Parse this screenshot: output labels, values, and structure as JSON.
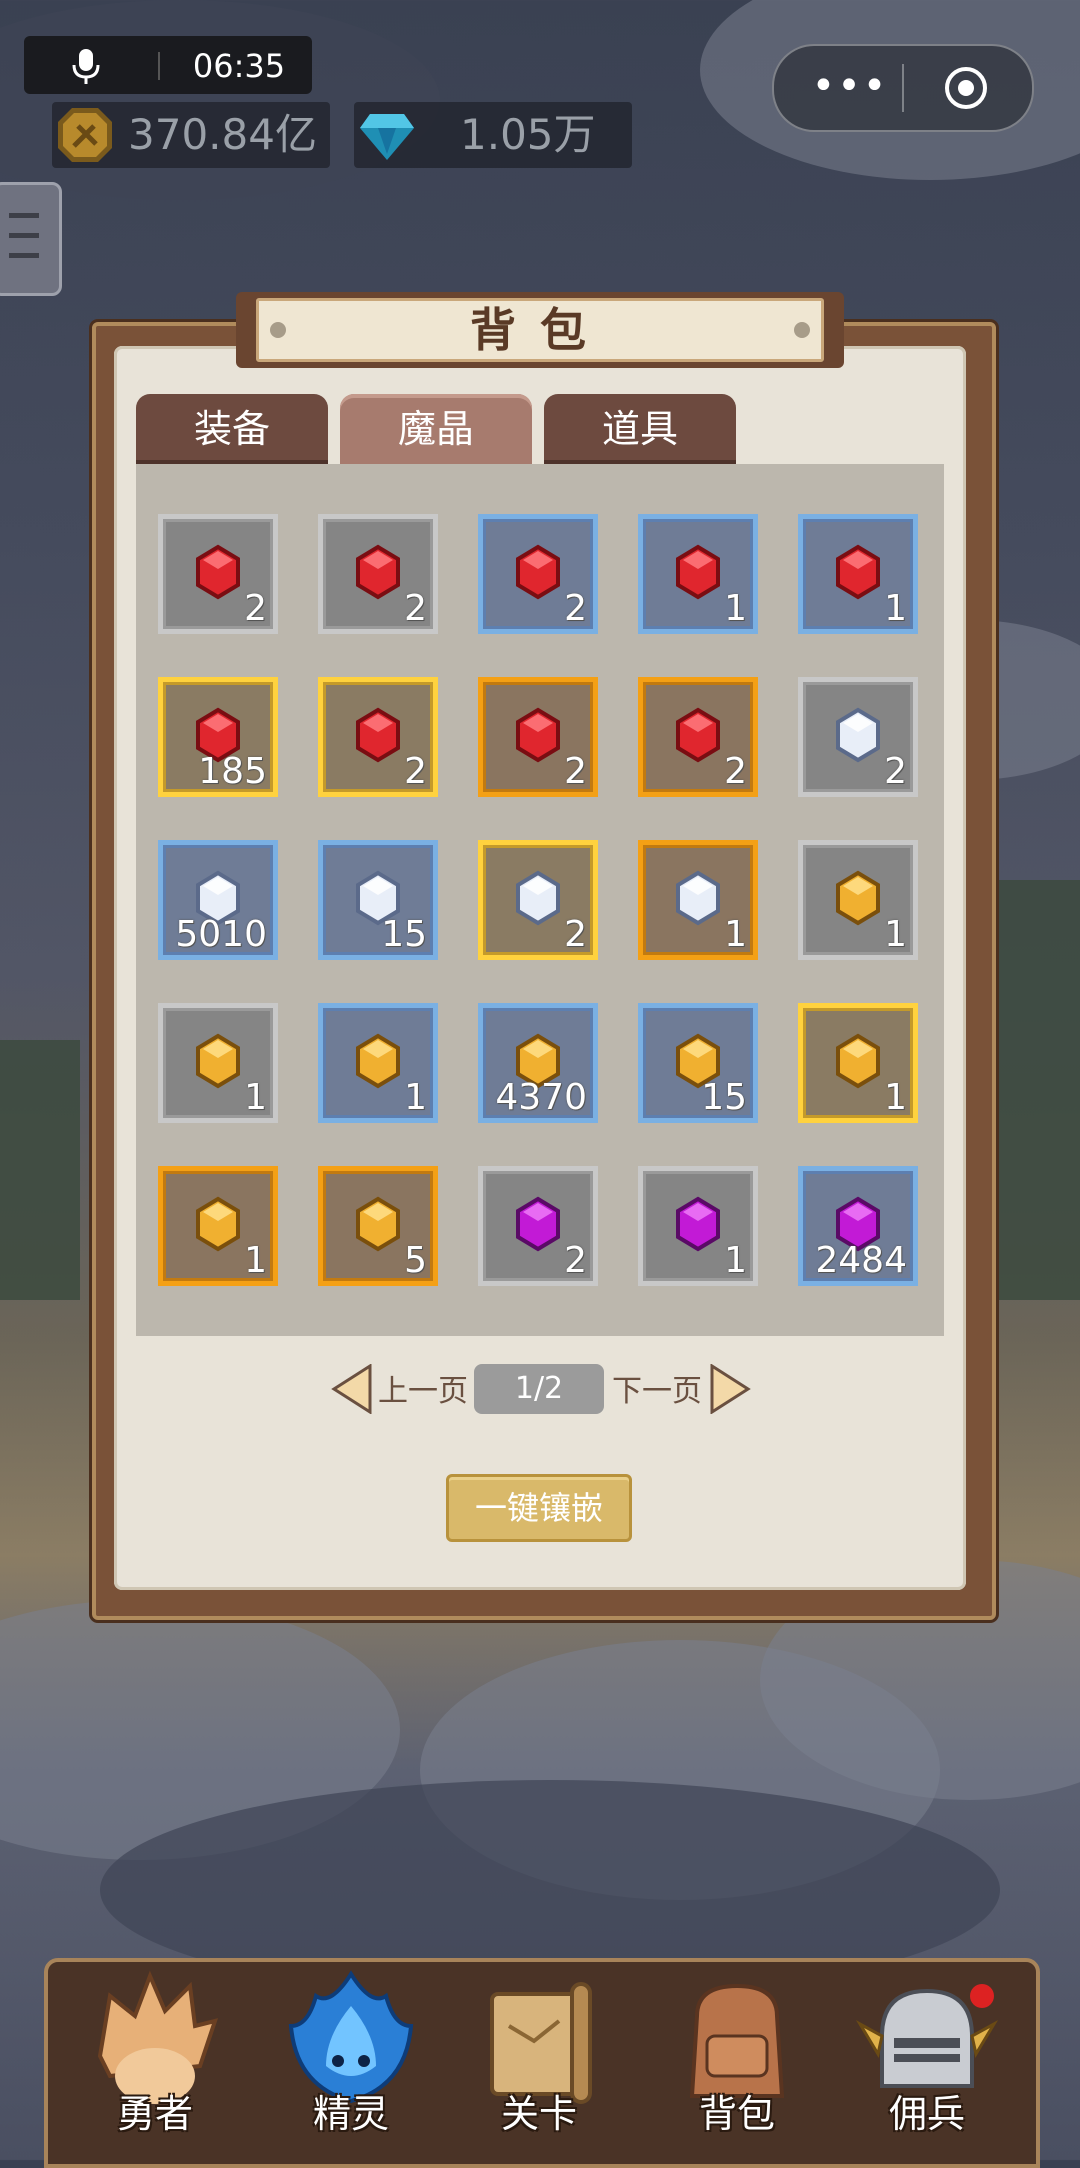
{
  "status": {
    "time": "06:35"
  },
  "currency": {
    "gold": "370.84亿",
    "diamond": "1.05万"
  },
  "panel": {
    "title": "背包",
    "tabs": [
      {
        "label": "装备",
        "active": false
      },
      {
        "label": "魔晶",
        "active": true
      },
      {
        "label": "道具",
        "active": false
      }
    ],
    "items": [
      {
        "count": "2",
        "rarity": "gray",
        "gem": "red"
      },
      {
        "count": "2",
        "rarity": "gray",
        "gem": "red"
      },
      {
        "count": "2",
        "rarity": "blue",
        "gem": "red"
      },
      {
        "count": "1",
        "rarity": "blue",
        "gem": "red"
      },
      {
        "count": "1",
        "rarity": "blue",
        "gem": "red"
      },
      {
        "count": "185",
        "rarity": "yellow",
        "gem": "red"
      },
      {
        "count": "2",
        "rarity": "yellow",
        "gem": "red"
      },
      {
        "count": "2",
        "rarity": "orange",
        "gem": "red"
      },
      {
        "count": "2",
        "rarity": "orange",
        "gem": "red"
      },
      {
        "count": "2",
        "rarity": "gray",
        "gem": "white"
      },
      {
        "count": "5010",
        "rarity": "blue",
        "gem": "white"
      },
      {
        "count": "15",
        "rarity": "blue",
        "gem": "white"
      },
      {
        "count": "2",
        "rarity": "yellow",
        "gem": "white"
      },
      {
        "count": "1",
        "rarity": "orange",
        "gem": "white"
      },
      {
        "count": "1",
        "rarity": "gray",
        "gem": "gold"
      },
      {
        "count": "1",
        "rarity": "gray",
        "gem": "gold"
      },
      {
        "count": "1",
        "rarity": "blue",
        "gem": "gold"
      },
      {
        "count": "4370",
        "rarity": "blue",
        "gem": "gold"
      },
      {
        "count": "15",
        "rarity": "blue",
        "gem": "gold"
      },
      {
        "count": "1",
        "rarity": "yellow",
        "gem": "gold"
      },
      {
        "count": "1",
        "rarity": "orange",
        "gem": "gold"
      },
      {
        "count": "5",
        "rarity": "orange",
        "gem": "gold"
      },
      {
        "count": "2",
        "rarity": "gray",
        "gem": "purple"
      },
      {
        "count": "1",
        "rarity": "gray",
        "gem": "purple"
      },
      {
        "count": "2484",
        "rarity": "blue",
        "gem": "purple"
      }
    ],
    "pager": {
      "prev": "上一页",
      "next": "下一页",
      "page": "1/2"
    },
    "inlay_button": "一键镶嵌"
  },
  "bottom_nav": [
    {
      "label": "勇者",
      "icon": "hero-icon"
    },
    {
      "label": "精灵",
      "icon": "spirit-icon"
    },
    {
      "label": "关卡",
      "icon": "map-scroll-icon"
    },
    {
      "label": "背包",
      "icon": "backpack-icon"
    },
    {
      "label": "佣兵",
      "icon": "knight-helmet-icon"
    }
  ],
  "colors": {
    "gem_red": "#e0262e",
    "gem_white": "#e8eef8",
    "gem_gold": "#f0b030",
    "gem_purple": "#c21ad6",
    "rarity_gray": "#c8c8c8",
    "rarity_blue": "#7ab0e3",
    "rarity_yellow": "#ffd23e",
    "rarity_orange": "#f4a015"
  }
}
